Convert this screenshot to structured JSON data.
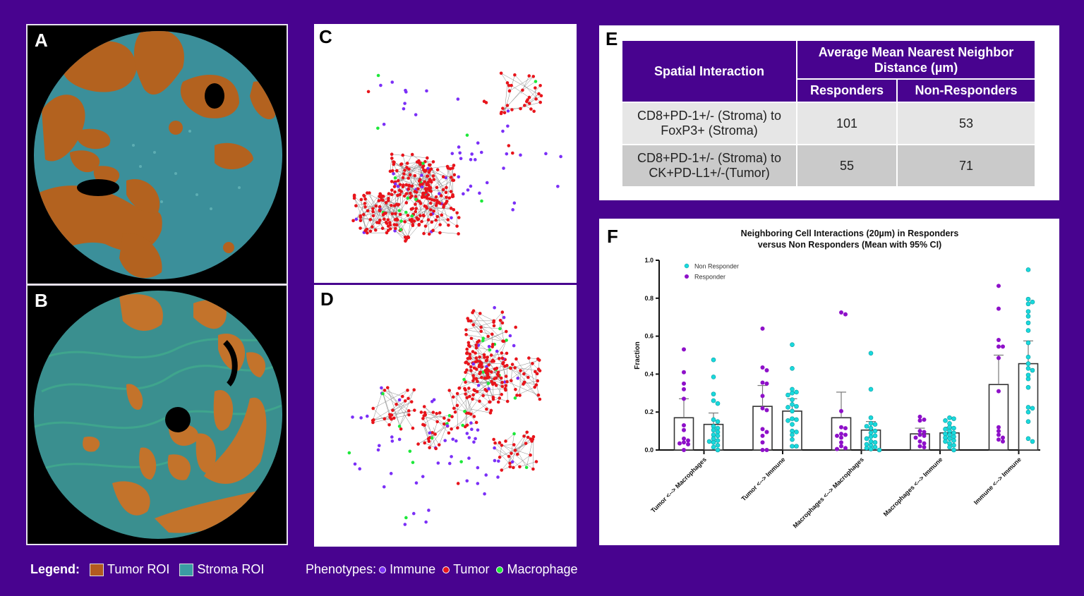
{
  "panels": {
    "a": {
      "letter": "A",
      "description": "Multiplex IF tissue core with Tumor ROI and Stroma ROI overlay"
    },
    "b": {
      "letter": "B",
      "description": "Multiplex IF tissue core with Tumor ROI and Stroma ROI overlay"
    },
    "c": {
      "letter": "C",
      "description": "Cell phenotype spatial network map"
    },
    "d": {
      "letter": "D",
      "description": "Cell phenotype spatial network map"
    },
    "e": {
      "letter": "E"
    },
    "f": {
      "letter": "F"
    }
  },
  "colors": {
    "background": "#48038f",
    "tumor_roi": "#b25a1f",
    "stroma_roi": "#3a9ca3",
    "immune": "#7b2ff7",
    "tumor": "#e8141b",
    "macrophage": "#1ee83a",
    "responder": "#8e10c9",
    "non_responder": "#19d9dc"
  },
  "table": {
    "header_spatial": "Spatial Interaction",
    "header_group": "Average Mean Nearest Neighbor Distance (µm)",
    "header_group_line1": "Average Mean Nearest Neighbor",
    "header_group_line2": "Distance (µm)",
    "col_responders": "Responders",
    "col_non_responders": "Non-Responders",
    "rows": [
      {
        "interaction_line1": "CD8+PD-1+/- (Stroma) to",
        "interaction_line2": "FoxP3+ (Stroma)",
        "responders": "101",
        "non_responders": "53"
      },
      {
        "interaction_line1": "CD8+PD-1+/- (Stroma) to",
        "interaction_line2": "CK+PD-L1+/-(Tumor)",
        "responders": "55",
        "non_responders": "71"
      }
    ]
  },
  "legend": {
    "label": "Legend:",
    "tumor_roi": "Tumor ROI",
    "stroma_roi": "Stroma ROI",
    "phenotypes_label": "Phenotypes:",
    "immune": "Immune",
    "tumor": "Tumor",
    "macrophage": "Macrophage"
  },
  "chart_data": {
    "type": "bar",
    "title": "Neighboring Cell Interactions (20µm) in Responders versus Non Responders (Mean with 95% CI)",
    "title_line1": "Neighboring Cell Interactions (20µm) in Responders",
    "title_line2": "versus Non Responders (Mean with 95% CI)",
    "xlabel": "",
    "ylabel": "Fraction",
    "ylim": [
      0,
      1.0
    ],
    "yticks": [
      "0.0",
      "0.2",
      "0.4",
      "0.6",
      "0.8",
      "1.0"
    ],
    "grid": false,
    "legend_position": "top-left",
    "categories": [
      "Tumor <--> Macrophages",
      "Tumor <--> Immune",
      "Macrophages <--> Macrophages",
      "Macrophages <--> Immune",
      "Immune <--> Immune"
    ],
    "series": [
      {
        "name": "Responder",
        "means": [
          0.17,
          0.23,
          0.17,
          0.085,
          0.345
        ],
        "ci_upper": [
          0.27,
          0.34,
          0.305,
          0.115,
          0.5
        ],
        "points": [
          [
            0.53,
            0.41,
            0.35,
            0.32,
            0.27,
            0.13,
            0.105,
            0.06,
            0.05,
            0.04,
            0.035,
            0.03,
            0.0
          ],
          [
            0.64,
            0.435,
            0.42,
            0.355,
            0.35,
            0.285,
            0.22,
            0.21,
            0.11,
            0.095,
            0.075,
            0.04,
            0.0,
            0.0
          ],
          [
            0.725,
            0.715,
            0.205,
            0.12,
            0.115,
            0.085,
            0.08,
            0.075,
            0.065,
            0.04,
            0.02,
            0.01,
            0.005
          ],
          [
            0.175,
            0.16,
            0.155,
            0.1,
            0.095,
            0.08,
            0.075,
            0.065,
            0.045,
            0.035,
            0.02,
            0.015
          ],
          [
            0.865,
            0.745,
            0.58,
            0.545,
            0.545,
            0.485,
            0.31,
            0.12,
            0.1,
            0.08,
            0.065,
            0.055,
            0.045
          ]
        ]
      },
      {
        "name": "Non Responder",
        "means": [
          0.135,
          0.205,
          0.105,
          0.09,
          0.455
        ],
        "ci_upper": [
          0.195,
          0.27,
          0.15,
          0.12,
          0.575
        ],
        "points": [
          [
            0.475,
            0.385,
            0.295,
            0.26,
            0.245,
            0.16,
            0.15,
            0.125,
            0.115,
            0.105,
            0.095,
            0.08,
            0.075,
            0.06,
            0.05,
            0.045,
            0.04,
            0.025,
            0.015,
            0.0
          ],
          [
            0.555,
            0.43,
            0.32,
            0.305,
            0.3,
            0.29,
            0.265,
            0.24,
            0.23,
            0.225,
            0.205,
            0.165,
            0.16,
            0.155,
            0.135,
            0.1,
            0.095,
            0.08,
            0.055,
            0.02,
            0.02
          ],
          [
            0.51,
            0.32,
            0.17,
            0.14,
            0.135,
            0.125,
            0.115,
            0.1,
            0.09,
            0.075,
            0.07,
            0.06,
            0.045,
            0.04,
            0.03,
            0.025,
            0.015,
            0.01,
            0.005,
            0.0
          ],
          [
            0.17,
            0.165,
            0.155,
            0.14,
            0.12,
            0.115,
            0.11,
            0.1,
            0.09,
            0.085,
            0.08,
            0.07,
            0.065,
            0.06,
            0.05,
            0.045,
            0.035,
            0.025,
            0.015,
            0.0
          ],
          [
            0.95,
            0.795,
            0.78,
            0.77,
            0.73,
            0.705,
            0.67,
            0.63,
            0.565,
            0.49,
            0.455,
            0.43,
            0.42,
            0.395,
            0.375,
            0.33,
            0.225,
            0.22,
            0.2,
            0.15,
            0.06,
            0.045
          ]
        ]
      }
    ]
  }
}
